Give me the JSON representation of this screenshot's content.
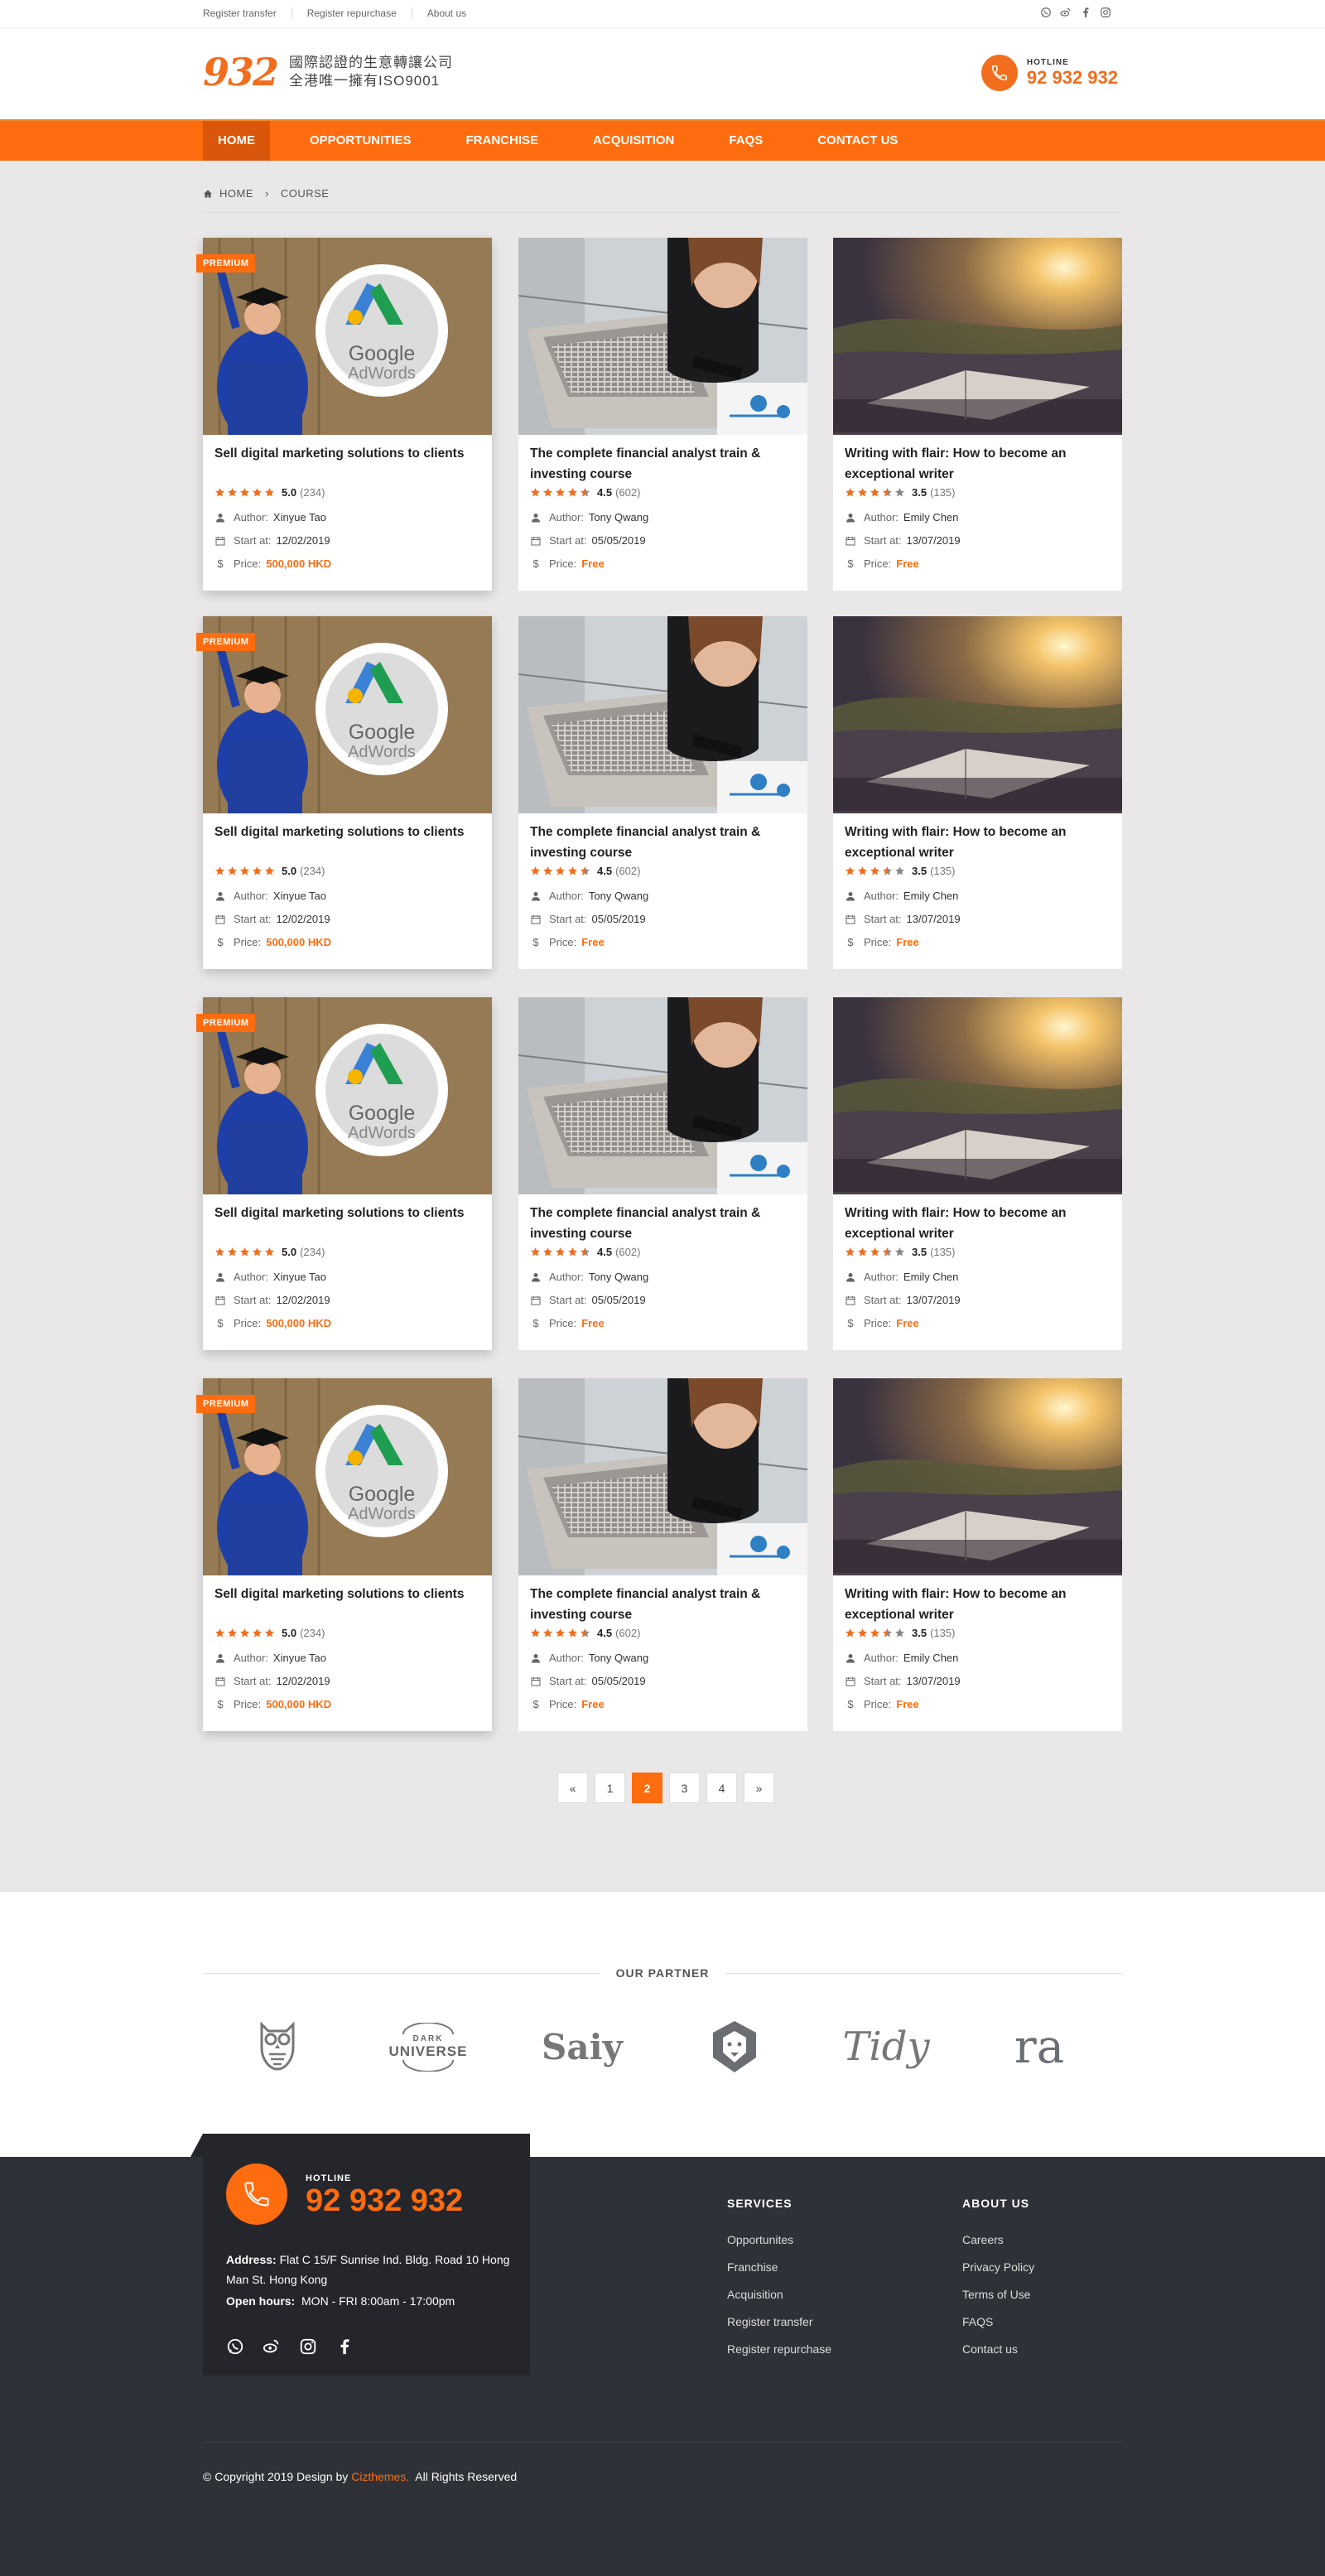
{
  "topbar": {
    "links": [
      "Register transfer",
      "Register repurchase",
      "About us"
    ],
    "social_icons": [
      "whatsapp-icon",
      "weibo-icon",
      "facebook-icon",
      "instagram-icon"
    ]
  },
  "header": {
    "logo_number": "932",
    "logo_line1": "國際認證的生意轉讓公司",
    "logo_line2": "全港唯一擁有ISO9001",
    "hotline_label": "HOTLINE",
    "hotline_number": "92 932 932"
  },
  "nav": {
    "items": [
      "HOME",
      "OPPORTUNITIES",
      "FRANCHISE",
      "ACQUISITION",
      "FAQS",
      "CONTACT US"
    ],
    "active": "HOME"
  },
  "breadcrumb": {
    "home": "HOME",
    "current": "COURSE"
  },
  "courses": [
    {
      "badge": "PREMIUM",
      "title": "Sell digital marketing solutions to clients",
      "rating": "5.0",
      "reviews": "(234)",
      "stars": 5,
      "author_label": "Author:",
      "author": "Xinyue  Tao",
      "start_label": "Start at:",
      "start": "12/02/2019",
      "price_label": "Price:",
      "price": "500,000 HKD",
      "image_text_1": "Google",
      "image_text_2": "AdWords"
    },
    {
      "badge": "",
      "title": "The complete financial analyst train & investing course",
      "rating": "4.5",
      "reviews": "(602)",
      "stars": 4.5,
      "author_label": "Author:",
      "author": "Tony Qwang",
      "start_label": "Start at:",
      "start": "05/05/2019",
      "price_label": "Price:",
      "price": "Free"
    },
    {
      "badge": "",
      "title": "Writing with flair: How to become an exceptional writer",
      "rating": "3.5",
      "reviews": "(135)",
      "stars": 3.5,
      "author_label": "Author:",
      "author": "Emily Chen",
      "start_label": "Start at:",
      "start": "13/07/2019",
      "price_label": "Price:",
      "price": "Free"
    }
  ],
  "pagination": {
    "prev": "«",
    "pages": [
      "1",
      "2",
      "3",
      "4"
    ],
    "active": "2",
    "next": "»"
  },
  "partners": {
    "title": "OUR PARTNER",
    "logos": [
      "owl-logo",
      "Dark Universe",
      "Saiy",
      "lion-logo",
      "Tidy",
      "ra"
    ],
    "dark_label": "DARK",
    "universe_label": "UNIVERSE",
    "saiy": "Saiy",
    "tidy": "Tidy",
    "ra": "ra"
  },
  "footer": {
    "hotline_label": "HOTLINE",
    "hotline_number": "92 932 932",
    "address_label": "Address:",
    "address": "Flat C 15/F Sunrise Ind. Bldg.  Road 10 Hong Man St. Hong Kong",
    "hours_label": "Open hours:",
    "hours": "MON - FRI  8:00am - 17:00pm",
    "services_title": "SERVICES",
    "services": [
      "Opportunites",
      "Franchise",
      "Acquisition",
      "Register transfer",
      "Register repurchase"
    ],
    "about_title": "ABOUT US",
    "about": [
      "Careers",
      "Privacy Policy",
      "Terms of Use",
      "FAQS",
      "Contact us"
    ],
    "copyright_prefix": "© Copyright 2019 Design by",
    "copyright_brand": "Cizthemes.",
    "copyright_suffix": "All Rights Reserved"
  },
  "colors": {
    "accent": "#fd6c0f",
    "nav_active": "#d9560a",
    "page_bg": "#e9e7e7",
    "footer_bg": "#2e3137",
    "footer_box": "#24262b"
  }
}
